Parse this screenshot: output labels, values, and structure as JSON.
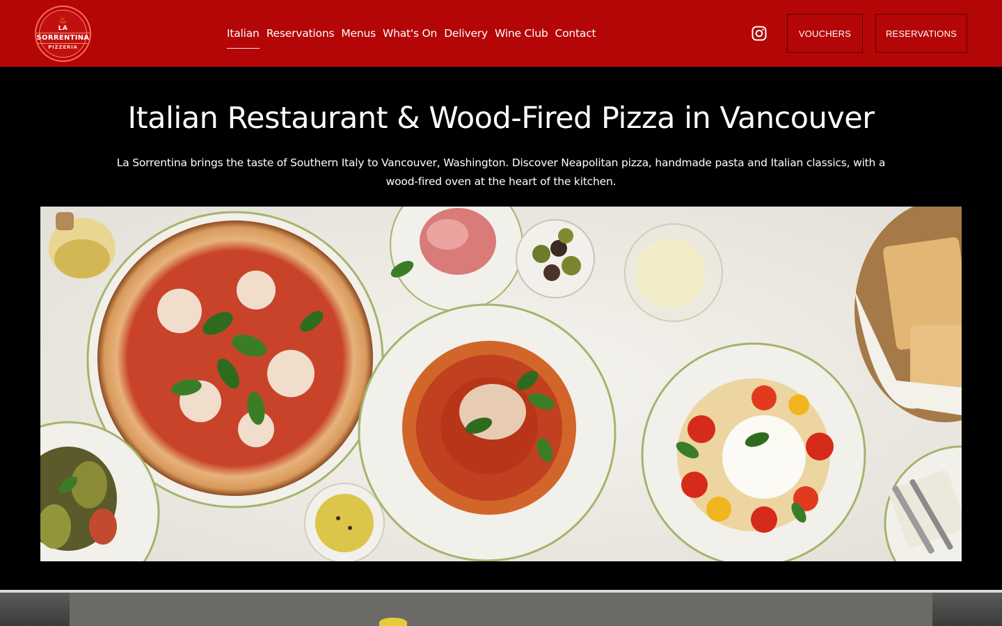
{
  "brand": {
    "logo_lines": [
      "LA",
      "SORRENTINA",
      "PIZZERIA"
    ],
    "colors": {
      "header_bg": "#b40606",
      "page_bg": "#000000",
      "accent": "#ff6a55"
    }
  },
  "nav": {
    "items": [
      {
        "label": "Italian",
        "active": true
      },
      {
        "label": "Reservations",
        "active": false
      },
      {
        "label": "Menus",
        "active": false
      },
      {
        "label": "What's On",
        "active": false
      },
      {
        "label": "Delivery",
        "active": false
      },
      {
        "label": "Wine Club",
        "active": false
      },
      {
        "label": "Contact",
        "active": false
      }
    ]
  },
  "header": {
    "social_icon": "instagram-icon",
    "vouchers_label": "VOUCHERS",
    "reservations_label": "RESERVATIONS"
  },
  "hero": {
    "title": "Italian Restaurant & Wood-Fired Pizza in Vancouver",
    "text_line1": "La Sorrentina brings the taste of Southern Italy to Vancouver, Washington. Discover Neapolitan pizza, handmade pasta and Italian classics, with a",
    "text_line2": "wood-fired oven at the heart of the kitchen."
  }
}
